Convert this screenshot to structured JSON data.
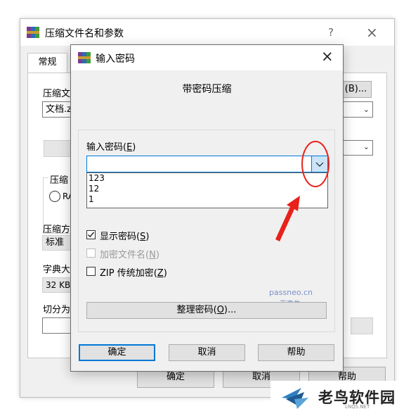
{
  "background_window": {
    "title": "压缩文件名和参数",
    "help_glyph": "?",
    "close_glyph": "×",
    "tab_general": "常规",
    "archive_name_label": "压缩文",
    "archive_name_value": "文档.z",
    "browse_button": "(B)...",
    "compression_label": "压缩",
    "radio_label": "RA",
    "method_label": "压缩方",
    "method_value": "标准",
    "dict_label": "字典大",
    "dict_value": "32 KB",
    "split_label": "切分为",
    "ok_button": "确定",
    "cancel_button": "取消",
    "help_button": "帮助"
  },
  "dialog": {
    "title": "输入密码",
    "close_glyph": "×",
    "heading": "带密码压缩",
    "password_label_pre": "输入密码(",
    "password_label_key": "E",
    "password_label_post": ")",
    "password_value": "",
    "history": [
      "123",
      "12",
      "1"
    ],
    "show_password_label_pre": "显示密码(",
    "show_password_key": "S",
    "show_password_post": ")",
    "show_password_checked": true,
    "encrypt_names_label_pre": "加密文件名(",
    "encrypt_names_key": "N",
    "encrypt_names_post": ")",
    "encrypt_names_checked": false,
    "zip_label_pre": "ZIP 传统加密(",
    "zip_key": "Z",
    "zip_post": ")",
    "zip_checked": false,
    "organize_button_pre": "整理密码(",
    "organize_button_key": "O",
    "organize_button_post": ")...",
    "ok_button": "确定",
    "cancel_button": "取消",
    "help_button": "帮助"
  },
  "watermark": {
    "line1": "passneo.cn",
    "line2": "百事牛"
  },
  "brand": {
    "name": "老鸟软件园",
    "url": "LNQS.NET"
  },
  "colors": {
    "accent_blue": "#0078d7",
    "annotation_red": "#e8211b"
  }
}
